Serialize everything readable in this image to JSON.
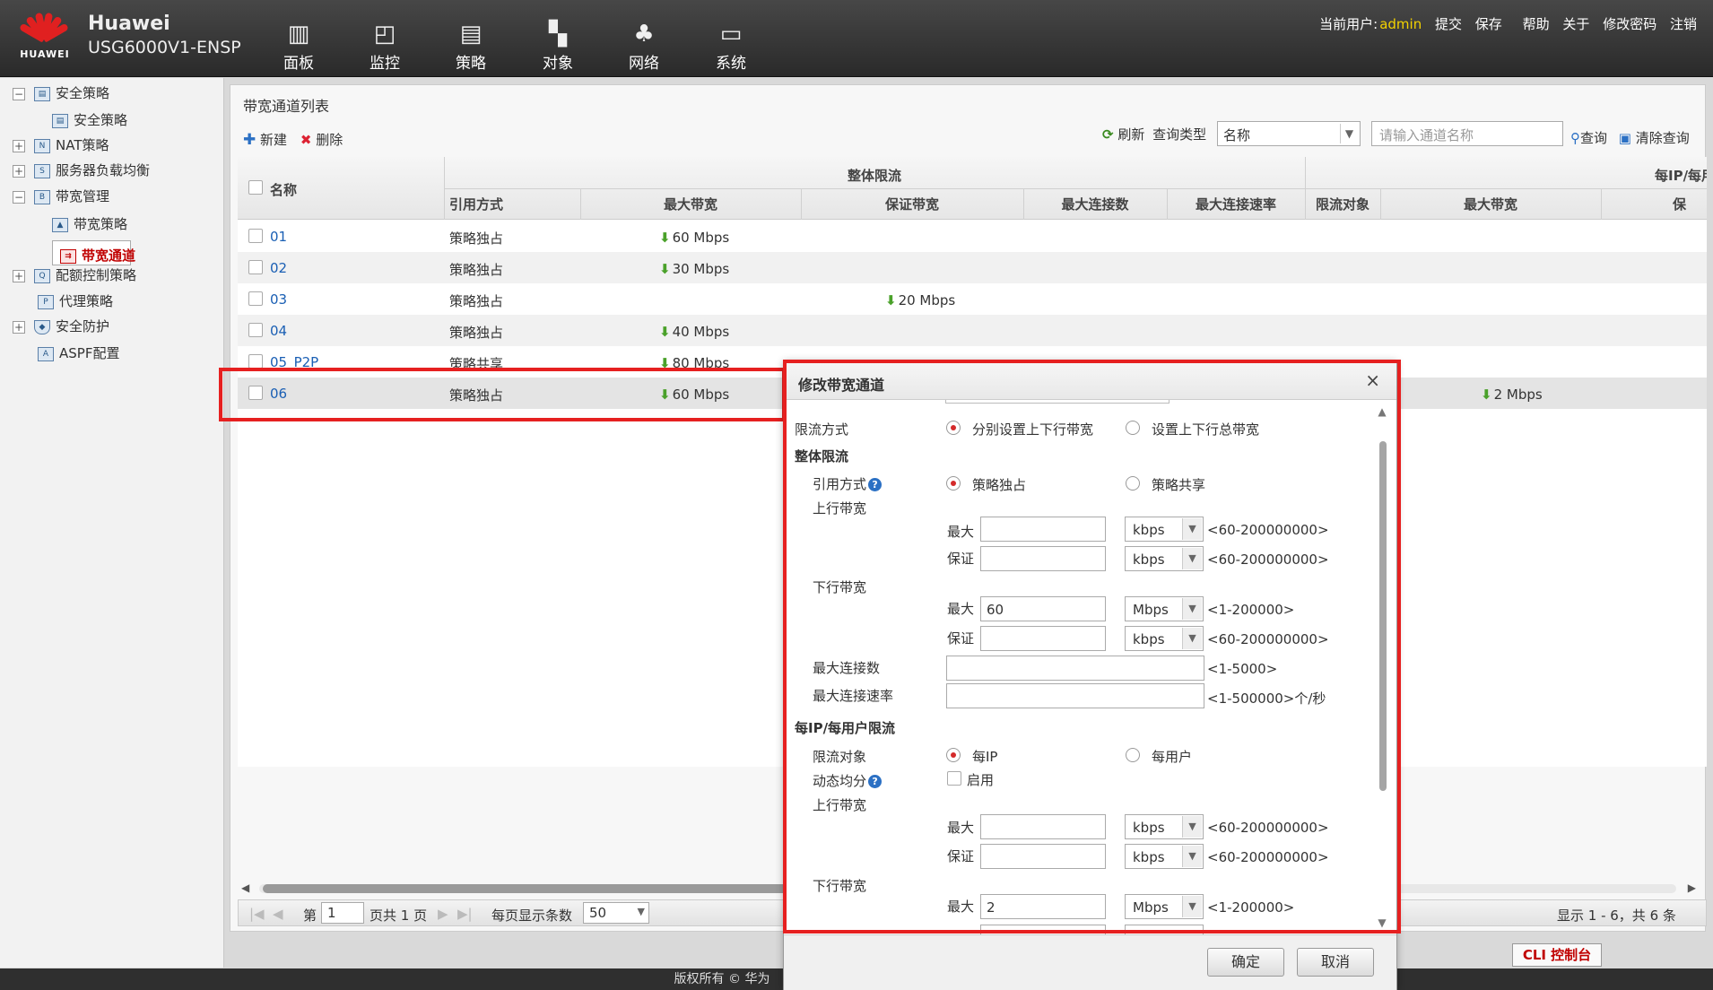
{
  "header": {
    "brand_short": "HUAWEI",
    "product_line1": "Huawei",
    "product_line2": "USG6000V1-ENSP",
    "nav": [
      {
        "label": "面板",
        "icon": "dashboard-icon"
      },
      {
        "label": "监控",
        "icon": "monitor-icon"
      },
      {
        "label": "策略",
        "icon": "policy-icon"
      },
      {
        "label": "对象",
        "icon": "object-icon"
      },
      {
        "label": "网络",
        "icon": "network-icon"
      },
      {
        "label": "系统",
        "icon": "system-icon"
      }
    ],
    "current_user_label": "当前用户:",
    "current_user": "admin",
    "links": [
      "提交",
      "保存",
      "帮助",
      "关于",
      "修改密码",
      "注销"
    ]
  },
  "sidebar": {
    "items": [
      {
        "label": "安全策略",
        "toggle": "−"
      },
      {
        "label": "安全策略",
        "toggle": ""
      },
      {
        "label": "NAT策略",
        "toggle": "+"
      },
      {
        "label": "服务器负载均衡",
        "toggle": "+"
      },
      {
        "label": "带宽管理",
        "toggle": "−"
      },
      {
        "label": "带宽策略",
        "toggle": ""
      },
      {
        "label": "带宽通道",
        "toggle": ""
      },
      {
        "label": "配额控制策略",
        "toggle": "+"
      },
      {
        "label": "代理策略",
        "toggle": ""
      },
      {
        "label": "安全防护",
        "toggle": "+"
      },
      {
        "label": "ASPF配置",
        "toggle": ""
      }
    ]
  },
  "main": {
    "title": "带宽通道列表",
    "toolbar": {
      "new": "新建",
      "delete": "删除"
    },
    "query": {
      "refresh": "刷新",
      "type_label": "查询类型",
      "type_value": "名称",
      "placeholder": "请输入通道名称",
      "search": "查询",
      "clear": "清除查询"
    },
    "table": {
      "group_overall": "整体限流",
      "group_per": "每IP/每用",
      "col_name": "名称",
      "col_mode": "引用方式",
      "col_max_bw": "最大带宽",
      "col_guar_bw": "保证带宽",
      "col_max_conn": "最大连接数",
      "col_max_rate": "最大连接速率",
      "col_target": "限流对象",
      "col_per_max_bw": "最大带宽",
      "col_per_guar": "保",
      "rows": [
        {
          "name": "01",
          "mode": "策略独占",
          "max_bw": "60 Mbps",
          "guar_bw": "",
          "per_max_bw": ""
        },
        {
          "name": "02",
          "mode": "策略独占",
          "max_bw": "30 Mbps",
          "guar_bw": "",
          "per_max_bw": ""
        },
        {
          "name": "03",
          "mode": "策略独占",
          "max_bw": "",
          "guar_bw": "20 Mbps",
          "per_max_bw": ""
        },
        {
          "name": "04",
          "mode": "策略独占",
          "max_bw": "40 Mbps",
          "guar_bw": "",
          "per_max_bw": ""
        },
        {
          "name": "05_P2P",
          "mode": "策略共享",
          "max_bw": "80 Mbps",
          "guar_bw": "",
          "per_max_bw": ""
        },
        {
          "name": "06",
          "mode": "策略独占",
          "max_bw": "60 Mbps",
          "guar_bw": "",
          "per_max_bw": "2 Mbps"
        }
      ]
    },
    "pager": {
      "page_prefix": "第",
      "page_value": "1",
      "page_suffix": "页共 1 页",
      "per_page_label": "每页显示条数",
      "per_page_value": "50",
      "summary": "显示 1 - 6，共 6 条"
    }
  },
  "modal": {
    "title": "修改带宽通道",
    "close": "×",
    "limit_mode_label": "限流方式",
    "limit_mode_opt1": "分别设置上下行带宽",
    "limit_mode_opt2": "设置上下行总带宽",
    "overall_section": "整体限流",
    "ref_mode_label": "引用方式",
    "ref_mode_opt1": "策略独占",
    "ref_mode_opt2": "策略共享",
    "up_bw_label": "上行带宽",
    "down_bw_label": "下行带宽",
    "max_label": "最大",
    "guar_label": "保证",
    "unit_kbps": "kbps",
    "unit_mbps": "Mbps",
    "range_kbps": "<60-200000000>",
    "range_mbps": "<1-200000>",
    "overall_down_max": "60",
    "max_conn_label": "最大连接数",
    "max_conn_range": "<1-5000>",
    "max_rate_label": "最大连接速率",
    "max_rate_range": "<1-500000>个/秒",
    "per_section": "每IP/每用户限流",
    "target_label": "限流对象",
    "target_opt1": "每IP",
    "target_opt2": "每用户",
    "dyn_label": "动态均分",
    "dyn_enable": "启用",
    "per_down_max": "2",
    "help": "?",
    "ok": "确定",
    "cancel": "取消"
  },
  "footer": {
    "copyright": "版权所有 © 华为",
    "cli": "CLI 控制台"
  }
}
